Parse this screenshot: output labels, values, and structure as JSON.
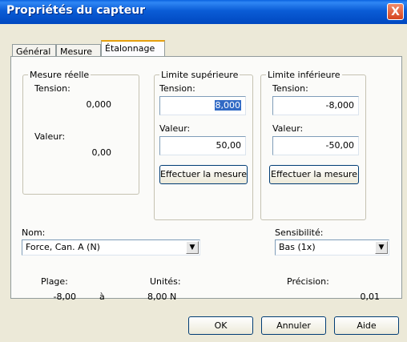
{
  "window": {
    "title": "Propriétés du capteur",
    "close_label": "X"
  },
  "tabs": [
    {
      "label": "Général",
      "active": false
    },
    {
      "label": "Mesure",
      "active": false
    },
    {
      "label": "Étalonnage",
      "active": true
    }
  ],
  "mesure_reelle": {
    "title": "Mesure réelle",
    "tension_label": "Tension:",
    "tension_value": "0,000",
    "valeur_label": "Valeur:",
    "valeur_value": "0,00"
  },
  "limite_sup": {
    "title": "Limite supérieure",
    "tension_label": "Tension:",
    "tension_value": "8,000",
    "valeur_label": "Valeur:",
    "valeur_value": "50,00",
    "button_label": "Effectuer la mesure"
  },
  "limite_inf": {
    "title": "Limite inférieure",
    "tension_label": "Tension:",
    "tension_value": "-8,000",
    "valeur_label": "Valeur:",
    "valeur_value": "-50,00",
    "button_label": "Effectuer la mesure"
  },
  "nom": {
    "label": "Nom:",
    "value": "Force, Can. A (N)"
  },
  "sensibilite": {
    "label": "Sensibilité:",
    "value": "Bas (1x)"
  },
  "info": {
    "plage_label": "Plage:",
    "plage_min": "-8,00",
    "plage_sep": "à",
    "plage_max": "8,00 N",
    "unites_label": "Unités:",
    "precision_label": "Précision:",
    "precision_value": "0,01"
  },
  "buttons": {
    "ok": "OK",
    "annuler": "Annuler",
    "aide": "Aide"
  },
  "colors": {
    "title_bar": "#0a5cd6",
    "close": "#d5441e",
    "selection": "#316ac5",
    "tab_accent": "#e6a00e"
  }
}
